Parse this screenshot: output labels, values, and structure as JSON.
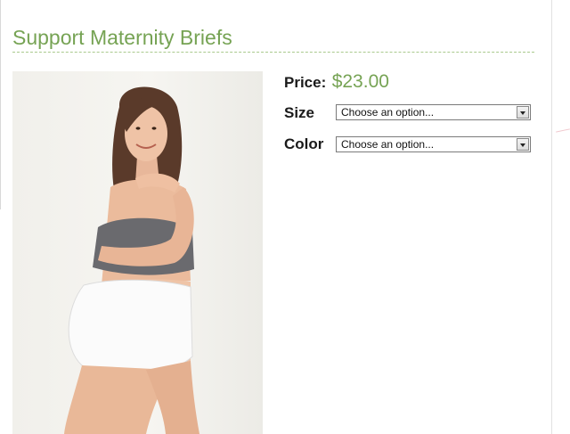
{
  "product": {
    "title": "Support Maternity Briefs",
    "image_alt": "Pregnant woman wearing white support maternity briefs and grey bra"
  },
  "price": {
    "label": "Price:",
    "value": "$23.00"
  },
  "options": [
    {
      "label": "Size",
      "selected": "Choose an option..."
    },
    {
      "label": "Color",
      "selected": "Choose an option..."
    }
  ],
  "icons": {
    "dropdown": "chevron-down-icon"
  },
  "colors": {
    "accent_green": "#76a354",
    "rule_green": "#a9c98d",
    "text_dark": "#1a1a1a"
  }
}
